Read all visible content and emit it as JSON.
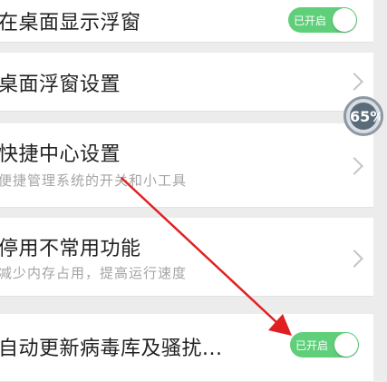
{
  "rows": [
    {
      "title": "在桌面显示浮窗",
      "toggle_label": "已开启"
    },
    {
      "title": "桌面浮窗设置"
    },
    {
      "title": "快捷中心设置",
      "subtitle": "便捷管理系统的开关和小工具"
    },
    {
      "title": "停用不常用功能",
      "subtitle": "减少内存占用，提高运行速度"
    },
    {
      "title": "自动更新病毒库及骚扰...",
      "toggle_label": "已开启"
    }
  ],
  "floating_badge": {
    "percent": "65%"
  },
  "colors": {
    "toggle_on": "#5fcf7a",
    "arrow": "#e02020",
    "background": "#ececec"
  }
}
